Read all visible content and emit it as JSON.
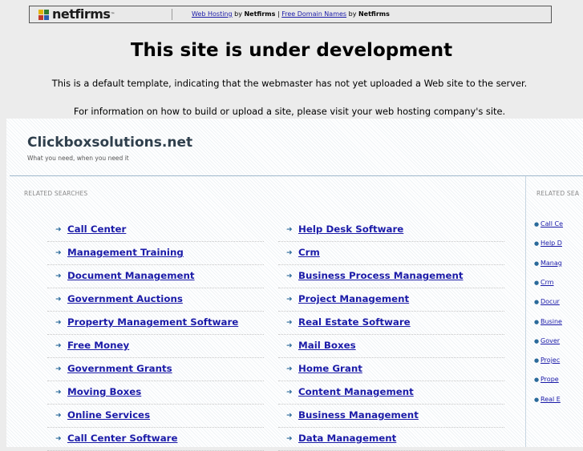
{
  "banner": {
    "logo_text": "netfirms",
    "logo_tm": "™",
    "link1": "Web Hosting",
    "by1": "by",
    "brand1": "Netfirms",
    "separator": "|",
    "link2": "Free Domain Names",
    "by2": "by",
    "brand2": "Netfirms"
  },
  "dev": {
    "title": "This site is under development",
    "line1": "This is a default template, indicating that the webmaster has not yet uploaded a Web site to the server.",
    "line2": "For information on how to build or upload a site, please visit your web hosting company's site."
  },
  "site": {
    "title": "Clickboxsolutions.net",
    "tagline": "What you need, when you need it",
    "related_label": "RELATED SEARCHES",
    "related_label_right": "RELATED SEA"
  },
  "left_links": {
    "col1": [
      "Call Center",
      "Management Training",
      "Document Management",
      "Government Auctions",
      "Property Management Software",
      "Free Money",
      "Government Grants",
      "Moving Boxes",
      "Online Services",
      "Call Center Software"
    ],
    "col2": [
      "Help Desk Software",
      "Crm",
      "Business Process Management",
      "Project Management",
      "Real Estate Software",
      "Mail Boxes",
      "Home Grant",
      "Content Management",
      "Business Management",
      "Data Management"
    ]
  },
  "right_links": [
    "Call Ce",
    "Help D",
    "Manag",
    "Crm",
    "Docur",
    "Busine",
    "Gover",
    "Projec",
    "Prope",
    "Real E"
  ],
  "colors": {
    "link": "#1b1ba8",
    "arrow": "#2a6a9a",
    "background": "#ececec"
  }
}
